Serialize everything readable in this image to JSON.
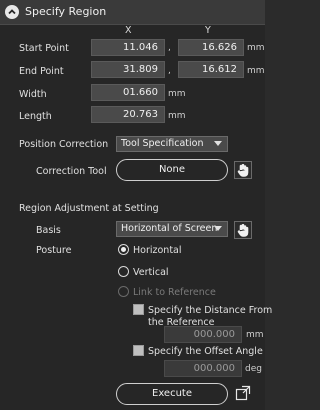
{
  "header": {
    "title": "Specify Region"
  },
  "columns": {
    "x": "X",
    "y": "Y"
  },
  "start_point": {
    "label": "Start Point",
    "x": "11.046",
    "sep": ",",
    "y": "16.626",
    "unit": "mm"
  },
  "end_point": {
    "label": "End Point",
    "x": "31.809",
    "sep": ",",
    "y": "16.612",
    "unit": "mm"
  },
  "width": {
    "label": "Width",
    "value": "01.660",
    "unit": "mm"
  },
  "length": {
    "label": "Length",
    "value": "20.763",
    "unit": "mm"
  },
  "position_correction": {
    "label": "Position Correction",
    "selected": "Tool Specification"
  },
  "correction_tool": {
    "label": "Correction Tool",
    "button": "None"
  },
  "region_adjustment": {
    "title": "Region Adjustment at Setting",
    "basis_label": "Basis",
    "basis_selected": "Horizontal of Screen",
    "posture_label": "Posture",
    "options": {
      "horizontal": "Horizontal",
      "vertical": "Vertical",
      "link": "Link to Reference"
    },
    "distance_checkbox_line1": "Specify the Distance From",
    "distance_checkbox_line2": "the Reference",
    "distance_value": "000.000",
    "distance_unit": "mm",
    "offset_checkbox": "Specify the Offset Angle",
    "offset_value": "000.000",
    "offset_unit": "deg"
  },
  "execute": {
    "label": "Execute"
  },
  "icons": {
    "collapse": "chevron-up-circle-icon",
    "hand": "hand-pointer-icon",
    "popout": "popout-window-icon"
  }
}
